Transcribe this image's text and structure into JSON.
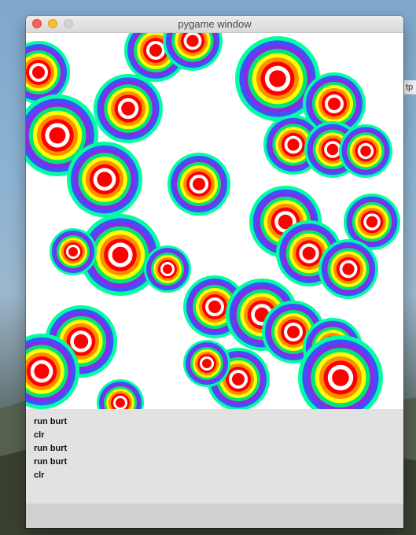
{
  "window": {
    "title": "pygame window"
  },
  "desktop": {
    "peek_text": "tp"
  },
  "palette": {
    "ring_colors": [
      "#ff0000",
      "#ffffff",
      "#ff0000",
      "#ff8c00",
      "#ffff00",
      "#00e676",
      "#8a2be2",
      "#3f51ff",
      "#00ffa0"
    ],
    "canvas_bg": "#ffffff",
    "console_bg": "#e3e2e3"
  },
  "console": {
    "lines": [
      "run burt",
      "clr",
      "run burt",
      "run burt",
      "clr"
    ]
  }
}
